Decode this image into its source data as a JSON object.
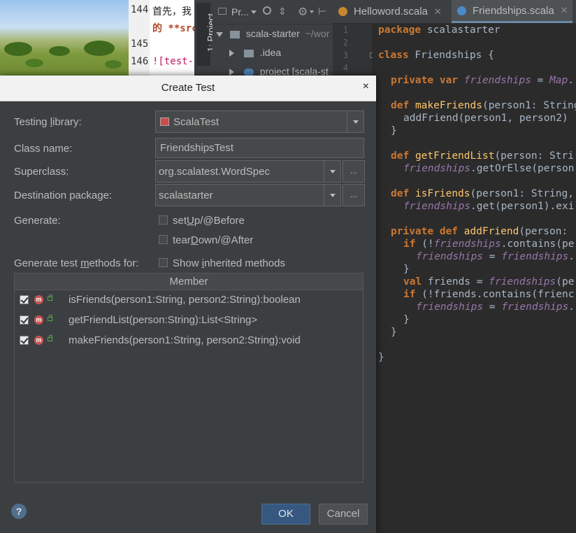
{
  "colors": {
    "dialog_bg": "#3c3f41",
    "editor_bg": "#2b2b2b",
    "keyword": "#cc7832",
    "function": "#ffc66d",
    "field": "#9876aa",
    "primary_button": "#365880"
  },
  "markdown_editor": {
    "lines": [
      {
        "number": "144",
        "text": "首先，我"
      },
      {
        "number": "",
        "text": "的 **src"
      },
      {
        "number": "145",
        "text": ""
      },
      {
        "number": "146",
        "text": "![test-c"
      }
    ]
  },
  "tool_strip": {
    "tab_label": "1: Project"
  },
  "project_panel": {
    "dropdown_label": "Pr...",
    "icons": [
      "target-icon",
      "split-icon",
      "gear-icon",
      "collapse-icon"
    ],
    "tree": [
      {
        "label": "scala-starter",
        "hint": "~/wor",
        "icon": "folder-icon"
      },
      {
        "label": ".idea",
        "icon": "folder-icon"
      },
      {
        "label": "project [scala-st",
        "icon": "module-icon"
      }
    ]
  },
  "editor": {
    "tabs": [
      {
        "label": "Helloword.scala",
        "active": false,
        "icon": "scala-object-icon"
      },
      {
        "label": "Friendships.scala",
        "active": true,
        "icon": "scala-class-icon"
      }
    ],
    "line_numbers": [
      "1",
      "2",
      "3",
      "4"
    ]
  },
  "dialog": {
    "title": "Create Test",
    "close_symbol": "×",
    "testing_library": {
      "label_before": "Testing ",
      "label_underlined": "l",
      "label_after": "ibrary:",
      "value": "ScalaTest"
    },
    "class_name": {
      "label": "Class name:",
      "value": "FriendshipsTest"
    },
    "superclass": {
      "label": "Superclass:",
      "value": "org.scalatest.WordSpec",
      "button": "..."
    },
    "destination_package": {
      "label": "Destination package:",
      "value": "scalastarter",
      "button": "..."
    },
    "generate": {
      "label": "Generate:",
      "setup": {
        "before": "set",
        "underlined": "U",
        "after": "p/@Before",
        "checked": false
      },
      "teardown": {
        "before": "tear",
        "underlined": "D",
        "after": "own/@After",
        "checked": false
      }
    },
    "methods_for": {
      "label_before": "Generate test ",
      "label_underlined": "m",
      "label_after": "ethods for:",
      "show_inherited": {
        "before": "Show ",
        "underlined": "i",
        "after": "nherited methods",
        "checked": false
      }
    },
    "table": {
      "header": "Member",
      "rows": [
        {
          "text": "isFriends(person1:String, person2:String):boolean",
          "checked": true
        },
        {
          "text": "getFriendList(person:String):List<String>",
          "checked": true
        },
        {
          "text": "makeFriends(person1:String, person2:String):void",
          "checked": true
        }
      ]
    },
    "help_symbol": "?",
    "ok_label": "OK",
    "cancel_label": "Cancel"
  }
}
